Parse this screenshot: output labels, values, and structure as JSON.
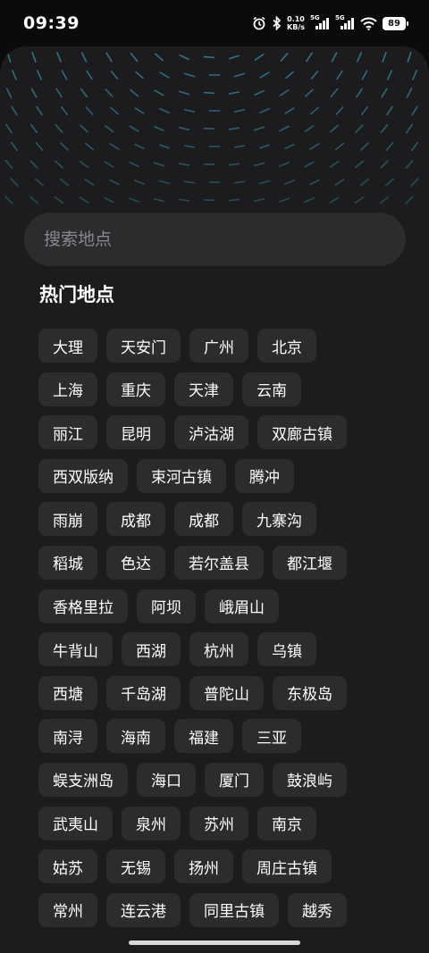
{
  "status_bar": {
    "time": "09:39",
    "net_speed_value": "0.10",
    "net_speed_unit": "KB/s",
    "signal_1_label": "5G",
    "signal_2_label": "5G",
    "battery": "89"
  },
  "search": {
    "placeholder": "搜索地点"
  },
  "hot_places": {
    "title": "热门地点",
    "rows": [
      [
        "大理",
        "天安门",
        "广州",
        "北京"
      ],
      [
        "上海",
        "重庆",
        "天津",
        "云南"
      ],
      [
        "丽江",
        "昆明",
        "泸沽湖",
        "双廊古镇"
      ],
      [
        "西双版纳",
        "束河古镇",
        "腾冲"
      ],
      [
        "雨崩",
        "成都",
        "成都",
        "九寨沟"
      ],
      [
        "稻城",
        "色达",
        "若尔盖县",
        "都江堰"
      ],
      [
        "香格里拉",
        "阿坝",
        "峨眉山"
      ],
      [
        "牛背山",
        "西湖",
        "杭州",
        "乌镇"
      ],
      [
        "西塘",
        "千岛湖",
        "普陀山",
        "东极岛"
      ],
      [
        "南浔",
        "海南",
        "福建",
        "三亚"
      ],
      [
        "蜈支洲岛",
        "海口",
        "厦门",
        "鼓浪屿"
      ],
      [
        "武夷山",
        "泉州",
        "苏州",
        "南京"
      ],
      [
        "姑苏",
        "无锡",
        "扬州",
        "周庄古镇"
      ],
      [
        "常州",
        "连云港",
        "同里古镇",
        "越秀"
      ]
    ]
  },
  "colors": {
    "background": "#1c1c1e",
    "tag_background": "#2c2c2e",
    "pattern_accent": "#2f7f96"
  }
}
